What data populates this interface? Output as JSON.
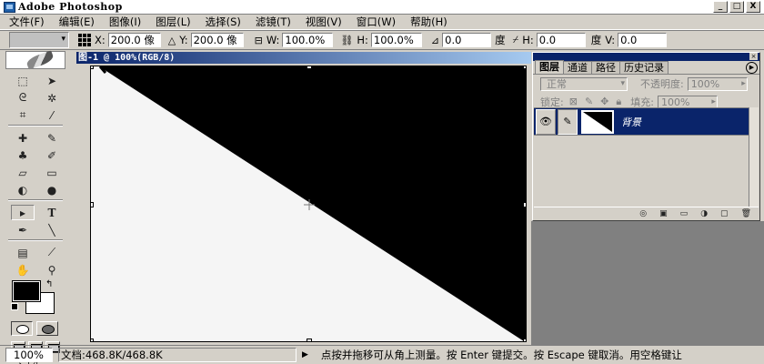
{
  "window": {
    "title": "Adobe Photoshop",
    "btn_min": "_",
    "btn_max": "□",
    "btn_close": "X"
  },
  "menu": [
    "文件(F)",
    "编辑(E)",
    "图像(I)",
    "图层(L)",
    "选择(S)",
    "滤镜(T)",
    "视图(V)",
    "窗口(W)",
    "帮助(H)"
  ],
  "options": {
    "x_label": "X:",
    "x_value": "200.0 像",
    "y_label": "Y:",
    "y_value": "200.0 像",
    "w_label": "W:",
    "w_value": "100.0%",
    "h_label": "H:",
    "h_value": "100.0%",
    "angle_value": "0.0",
    "angle_unit": "度",
    "hskew_label": "H:",
    "hskew_value": "0.0",
    "hskew_unit": "度",
    "vskew_label": "V:",
    "vskew_value": "0.0"
  },
  "document": {
    "title": "图-1 @ 100%(RGB/8)"
  },
  "layers_panel": {
    "tabs": [
      "图层",
      "通道",
      "路径",
      "历史记录"
    ],
    "blend_mode": "正常",
    "opacity_label": "不透明度:",
    "opacity_value": "100%",
    "lock_label": "锁定:",
    "fill_label": "填充:",
    "fill_value": "100%",
    "layer_name": "背景"
  },
  "status": {
    "zoom": "100%",
    "doc_info": "文档:468.8K/468.8K",
    "hint": "点按并拖移可从角上测量。按 Enter 键提交。按 Escape 键取消。用空格键让"
  },
  "colors": {
    "foreground": "#000000",
    "background": "#ffffff",
    "selection": "#0a246a"
  }
}
